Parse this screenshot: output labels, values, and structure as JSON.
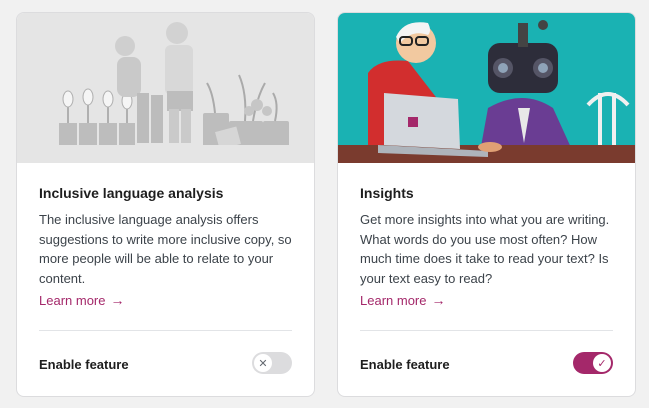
{
  "cards": [
    {
      "title": "Inclusive language analysis",
      "description": "The inclusive language analysis offers suggestions to write more inclusive copy, so more people will be able to relate to your content.",
      "learn_more": "Learn more",
      "arrow": "→",
      "feature_label": "Enable feature",
      "toggle_state": "off",
      "toggle_icon": "✕",
      "image_bg": "#e5e5e5"
    },
    {
      "title": "Insights",
      "description": "Get more insights into what you are writing. What words do you use most often? How much time does it take to read your text? Is your text easy to read?",
      "learn_more": "Learn more",
      "arrow": "→",
      "feature_label": "Enable feature",
      "toggle_state": "on",
      "toggle_icon": "✓",
      "image_bg": "#1ab2b3"
    }
  ],
  "colors": {
    "accent": "#a4286a",
    "toggle_off": "#dcdcde",
    "teal": "#1ab2b3"
  }
}
